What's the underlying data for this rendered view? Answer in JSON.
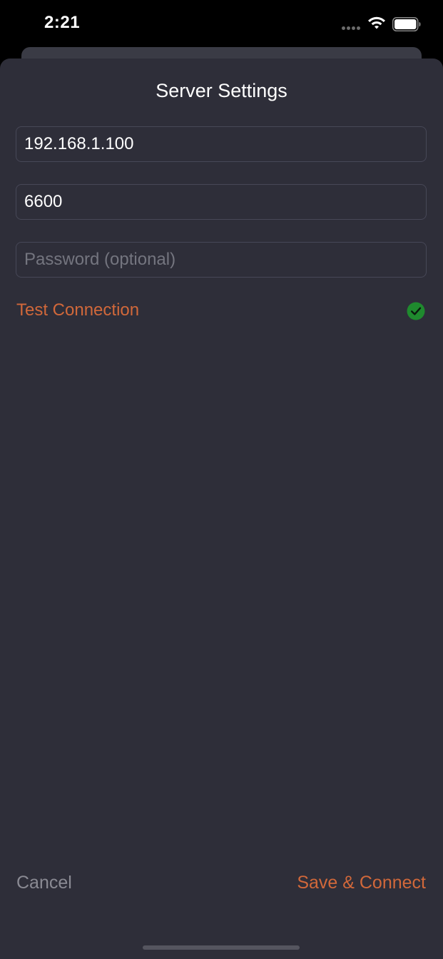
{
  "status_bar": {
    "time": "2:21",
    "signal_icon": "cellular-dots-icon",
    "wifi_icon": "wifi-icon",
    "battery_icon": "battery-full-icon"
  },
  "sheet": {
    "title": "Server Settings",
    "host": {
      "value": "192.168.1.100",
      "placeholder": ""
    },
    "port": {
      "value": "6600",
      "placeholder": ""
    },
    "password": {
      "value": "",
      "placeholder": "Password (optional)"
    },
    "test_connection_label": "Test Connection",
    "test_status_icon": "checkmark-circle-icon",
    "cancel_label": "Cancel",
    "save_label": "Save & Connect"
  },
  "colors": {
    "accent": "#d1683a",
    "background": "#2e2e39",
    "success": "#1f8a2e",
    "muted_text": "#8a8a93"
  }
}
